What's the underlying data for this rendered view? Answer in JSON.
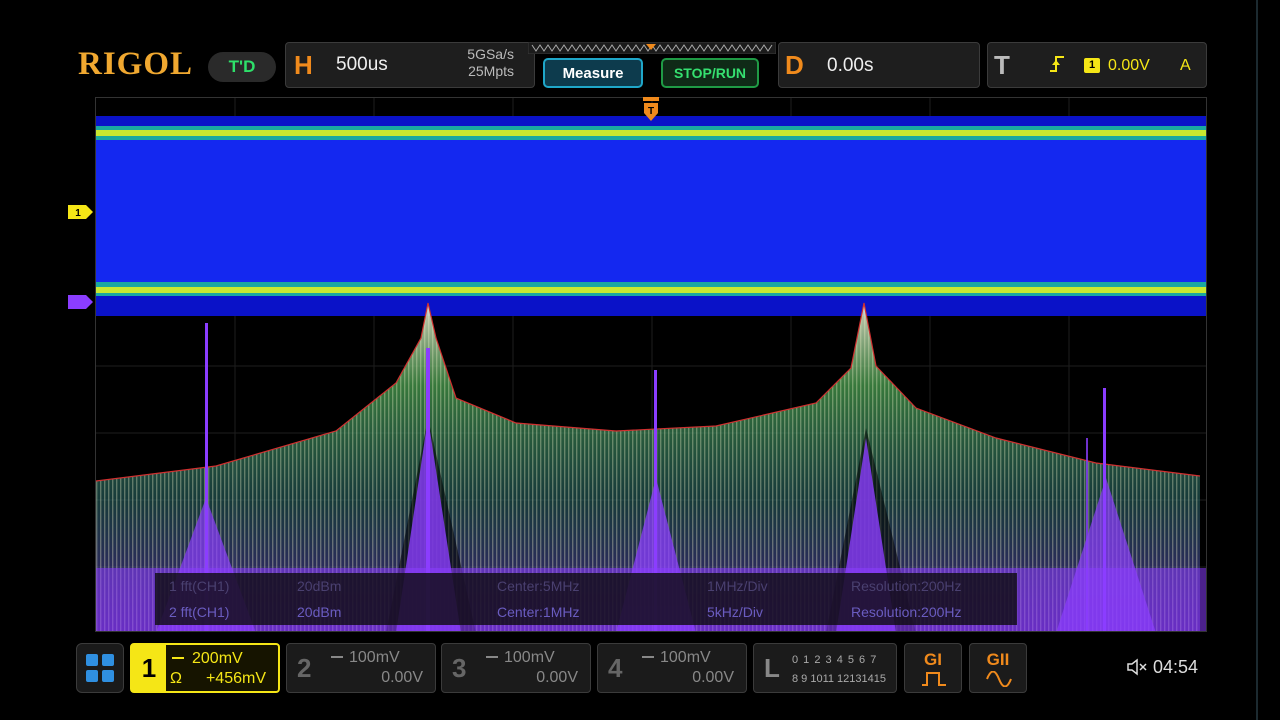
{
  "brand": {
    "logo": "RIGOL",
    "mode_badge": "T'D"
  },
  "horizontal": {
    "letter": "H",
    "timebase": "500us",
    "sample_rate": "5GSa/s",
    "memory_depth": "25Mpts"
  },
  "buttons": {
    "measure": "Measure",
    "stop_run": "STOP/RUN"
  },
  "delay": {
    "letter": "D",
    "value": "0.00s"
  },
  "trigger": {
    "letter": "T",
    "edge_icon": "rising-edge-icon",
    "source": "1",
    "level": "0.00V",
    "mode": "A"
  },
  "screen": {
    "trigger_marker": "T",
    "ch1_marker": "1",
    "fft_info": {
      "rows": [
        {
          "source": "1 fft(CH1)",
          "scale": "20dBm",
          "center": "Center:5MHz",
          "span": "1MHz/Div",
          "resolution": "Resolution:200Hz"
        },
        {
          "source": "2 fft(CH1)",
          "scale": "20dBm",
          "center": "Center:1MHz",
          "span": "5kHz/Div",
          "resolution": "Resolution:200Hz"
        }
      ]
    }
  },
  "channels": [
    {
      "num": "1",
      "scale": "200mV",
      "offset": "+456mV",
      "impedance": "Ω",
      "active": true,
      "color": "#f5e616"
    },
    {
      "num": "2",
      "scale": "100mV",
      "offset": "0.00V",
      "active": false
    },
    {
      "num": "3",
      "scale": "100mV",
      "offset": "0.00V",
      "active": false
    },
    {
      "num": "4",
      "scale": "100mV",
      "offset": "0.00V",
      "active": false
    }
  ],
  "logic": {
    "letter": "L",
    "row1": "0 1 2 3  4 5 6 7",
    "row2": "8 9 1011 12131415"
  },
  "generators": [
    {
      "label": "GI",
      "icon": "square-wave-icon"
    },
    {
      "label": "GII",
      "icon": "sine-wave-icon"
    }
  ],
  "status": {
    "mute_icon": "speaker-muted-icon",
    "time": "04:54"
  },
  "colors": {
    "accent_orange": "#f08a1c",
    "ch1_yellow": "#f5e616",
    "measure_cyan": "#1fa7c9",
    "run_green": "#35e070",
    "trace_blue": "#1428f0",
    "fft_purple": "#8b3dff"
  }
}
